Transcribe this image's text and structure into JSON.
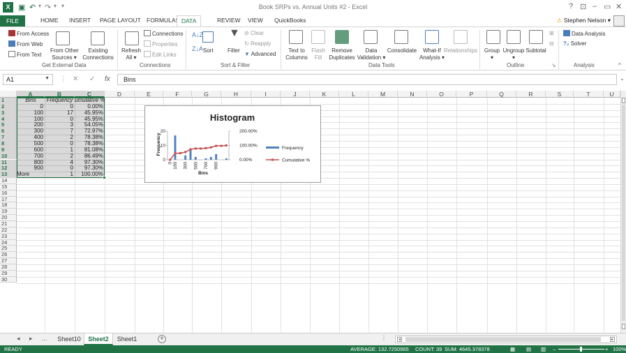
{
  "window": {
    "title": "Book SRPs vs. Annual Units #2 - Excel",
    "help": "?",
    "minimize": "–",
    "restore": "▭",
    "close": "✕"
  },
  "tabs": {
    "file": "FILE",
    "items": [
      "HOME",
      "INSERT",
      "PAGE LAYOUT",
      "FORMULAS",
      "DATA",
      "REVIEW",
      "VIEW",
      "QuickBooks"
    ],
    "active": "DATA",
    "user": "Stephen Nelson"
  },
  "ribbon": {
    "get_external": {
      "from_access": "From Access",
      "from_web": "From Web",
      "from_text": "From Text",
      "from_other_1": "From Other",
      "from_other_2": "Sources",
      "existing_1": "Existing",
      "existing_2": "Connections",
      "label": "Get External Data"
    },
    "connections": {
      "refresh_1": "Refresh",
      "refresh_2": "All",
      "connections": "Connections",
      "properties": "Properties",
      "edit_links": "Edit Links",
      "label": "Connections"
    },
    "sort_filter": {
      "sort": "Sort",
      "filter": "Filter",
      "clear": "Clear",
      "reapply": "Reapply",
      "advanced": "Advanced",
      "label": "Sort & Filter"
    },
    "data_tools": {
      "text_to_columns_1": "Text to",
      "text_to_columns_2": "Columns",
      "flash_fill_1": "Flash",
      "flash_fill_2": "Fill",
      "remove_dup_1": "Remove",
      "remove_dup_2": "Duplicates",
      "data_validation_1": "Data",
      "data_validation_2": "Validation",
      "consolidate": "Consolidate",
      "what_if_1": "What-If",
      "what_if_2": "Analysis",
      "relationships": "Relationships",
      "label": "Data Tools"
    },
    "outline": {
      "group": "Group",
      "ungroup": "Ungroup",
      "subtotal": "Subtotal",
      "label": "Outline"
    },
    "analysis": {
      "data_analysis": "Data Analysis",
      "solver": "Solver",
      "label": "Analysis"
    }
  },
  "formula_bar": {
    "name_box": "A1",
    "cancel": "✕",
    "enter": "✓",
    "fx": "fx",
    "content": "Bins"
  },
  "columns": [
    "A",
    "B",
    "C",
    "D",
    "E",
    "F",
    "G",
    "H",
    "I",
    "J",
    "K",
    "L",
    "M",
    "N",
    "O",
    "P",
    "Q",
    "R",
    "S",
    "T",
    "U"
  ],
  "rows": [
    "1",
    "2",
    "3",
    "4",
    "5",
    "6",
    "7",
    "8",
    "9",
    "10",
    "11",
    "12",
    "13",
    "14",
    "15",
    "16",
    "17",
    "18",
    "19",
    "20",
    "21",
    "22",
    "23",
    "24",
    "25",
    "26",
    "27",
    "28",
    "29",
    "30"
  ],
  "table": {
    "headers": [
      "Bins",
      "Frequency",
      "umulative %"
    ],
    "rows": [
      [
        "0",
        "0",
        "0.00%"
      ],
      [
        "100",
        "17",
        "45.95%"
      ],
      [
        "100",
        "0",
        "45.95%"
      ],
      [
        "200",
        "3",
        "54.05%"
      ],
      [
        "300",
        "7",
        "72.97%"
      ],
      [
        "400",
        "2",
        "78.38%"
      ],
      [
        "500",
        "0",
        "78.38%"
      ],
      [
        "600",
        "1",
        "81.08%"
      ],
      [
        "700",
        "2",
        "86.49%"
      ],
      [
        "800",
        "4",
        "97.30%"
      ],
      [
        "900",
        "0",
        "97.30%"
      ],
      [
        "More",
        "1",
        "100.00%"
      ]
    ]
  },
  "chart_data": {
    "type": "bar",
    "title": "Histogram",
    "xlabel": "Bins",
    "ylabel": "Frequency",
    "categories": [
      "0",
      "100",
      "100",
      "200",
      "300",
      "400",
      "500",
      "600",
      "700",
      "800",
      "900",
      "More"
    ],
    "x_tick_labels": [
      "0",
      "100",
      "",
      "300",
      "",
      "500",
      "",
      "700",
      "",
      "900",
      "",
      ""
    ],
    "series": [
      {
        "name": "Frequency",
        "type": "bar",
        "axis": "left",
        "color": "#4f81bd",
        "values": [
          0,
          17,
          0,
          3,
          7,
          2,
          0,
          1,
          2,
          4,
          0,
          1
        ]
      },
      {
        "name": "Cumulative %",
        "type": "line",
        "axis": "right",
        "color": "#c0504d",
        "values": [
          0.0,
          45.95,
          45.95,
          54.05,
          72.97,
          78.38,
          78.38,
          81.08,
          86.49,
          97.3,
          97.3,
          100.0
        ]
      }
    ],
    "ylim": [
      0,
      20
    ],
    "yticks": [
      "0",
      "10",
      "20"
    ],
    "y2lim": [
      0,
      200
    ],
    "y2ticks": [
      "0.00%",
      "100.00%",
      "200.00%"
    ],
    "legend": "right"
  },
  "sheets": {
    "more": "...",
    "tabs": [
      "Sheet10",
      "Sheet2",
      "Sheet1"
    ],
    "active": "Sheet2",
    "add": "+"
  },
  "status": {
    "mode": "READY",
    "average": "AVERAGE: 132.7250965",
    "count": "COUNT: 39",
    "sum": "SUM: 4645.378378",
    "zoom": "100%"
  },
  "colors": {
    "excel_green": "#217346",
    "bar_blue": "#4f81bd",
    "line_red": "#c0504d",
    "selection_gray": "#d6d6d6"
  }
}
